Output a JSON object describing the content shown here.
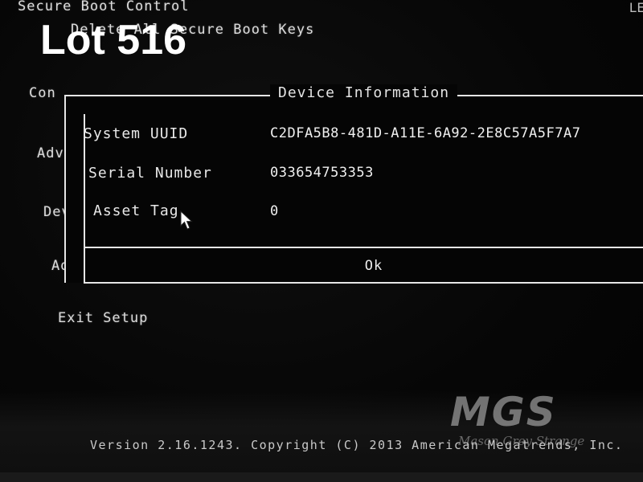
{
  "header": {
    "title": "Secure Boot Control",
    "subtitle": "Delete All Secure Boot Keys",
    "corner_text": "LE"
  },
  "overlay": {
    "lot_label": "Lot 516"
  },
  "menu": {
    "items": [
      "Con",
      "Adv",
      "Dev",
      "Adm"
    ],
    "exit": "Exit Setup"
  },
  "dialog": {
    "title": "Device Information",
    "rows": [
      {
        "label": "System UUID",
        "value": "C2DFA5B8-481D-A11E-6A92-2E8C57A5F7A7"
      },
      {
        "label": "Serial Number",
        "value": "033654753353"
      },
      {
        "label": "Asset Tag",
        "value": "0"
      }
    ],
    "ok_label": "Ok"
  },
  "footer": {
    "version": "Version 2.16.1243. Copyright (C) 2013 American Megatrends, Inc."
  },
  "watermark": {
    "logo_letters": "MGS",
    "tagline": "Mason Grey Strange"
  }
}
